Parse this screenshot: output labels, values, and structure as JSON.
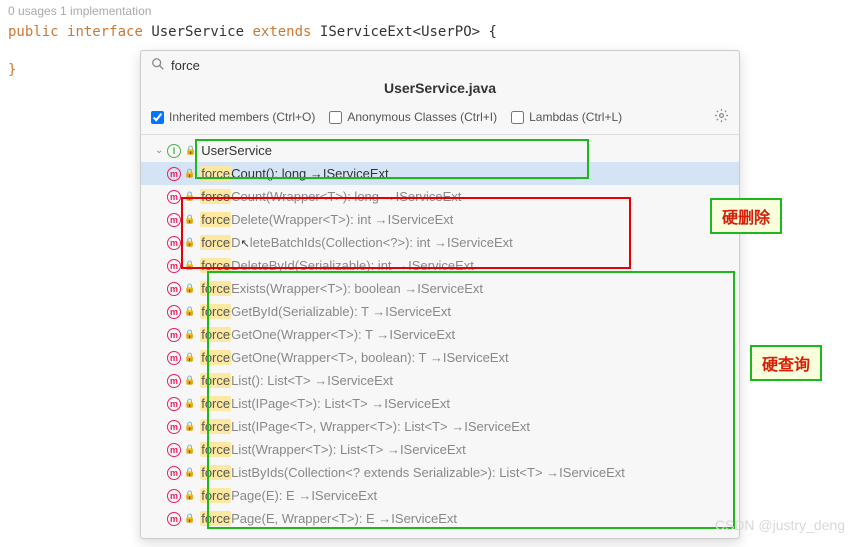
{
  "code_meta": "0 usages   1 implementation",
  "code": {
    "kw_public": "public",
    "kw_interface": "interface",
    "class_name": "UserService",
    "kw_extends": "extends",
    "base": "IServiceExt",
    "generic": "<UserPO>",
    "brace_open": " {",
    "brace_close": "}"
  },
  "popup": {
    "search_value": "force",
    "title": "UserService.java",
    "opts": {
      "inherited": "Inherited members (Ctrl+O)",
      "anon": "Anonymous Classes (Ctrl+I)",
      "lambdas": "Lambdas (Ctrl+L)"
    },
    "root": "UserService",
    "items": [
      {
        "m": "force",
        "sig": "Count(): long →IServiceExt",
        "sel": true
      },
      {
        "m": "force",
        "sig": "Count(Wrapper<T>): long →IServiceExt"
      },
      {
        "m": "force",
        "sig": "Delete(Wrapper<T>): int →IServiceExt"
      },
      {
        "m": "force",
        "sig": "DeleteBatchIds(Collection<?>): int →IServiceExt",
        "cursor": true
      },
      {
        "m": "force",
        "sig": "DeleteById(Serializable): int →IServiceExt"
      },
      {
        "m": "force",
        "sig": "Exists(Wrapper<T>): boolean →IServiceExt"
      },
      {
        "m": "force",
        "sig": "GetById(Serializable): T →IServiceExt"
      },
      {
        "m": "force",
        "sig": "GetOne(Wrapper<T>): T →IServiceExt"
      },
      {
        "m": "force",
        "sig": "GetOne(Wrapper<T>, boolean): T →IServiceExt"
      },
      {
        "m": "force",
        "sig": "List(): List<T> →IServiceExt"
      },
      {
        "m": "force",
        "sig": "List(IPage<T>): List<T> →IServiceExt"
      },
      {
        "m": "force",
        "sig": "List(IPage<T>, Wrapper<T>): List<T> →IServiceExt"
      },
      {
        "m": "force",
        "sig": "List(Wrapper<T>): List<T> →IServiceExt"
      },
      {
        "m": "force",
        "sig": "ListByIds(Collection<? extends Serializable>): List<T> →IServiceExt"
      },
      {
        "m": "force",
        "sig": "Page(E): E →IServiceExt"
      },
      {
        "m": "force",
        "sig": "Page(E, Wrapper<T>): E →IServiceExt"
      }
    ]
  },
  "anno1": "硬删除",
  "anno2": "硬查询",
  "watermark": "CSDN @justry_deng"
}
